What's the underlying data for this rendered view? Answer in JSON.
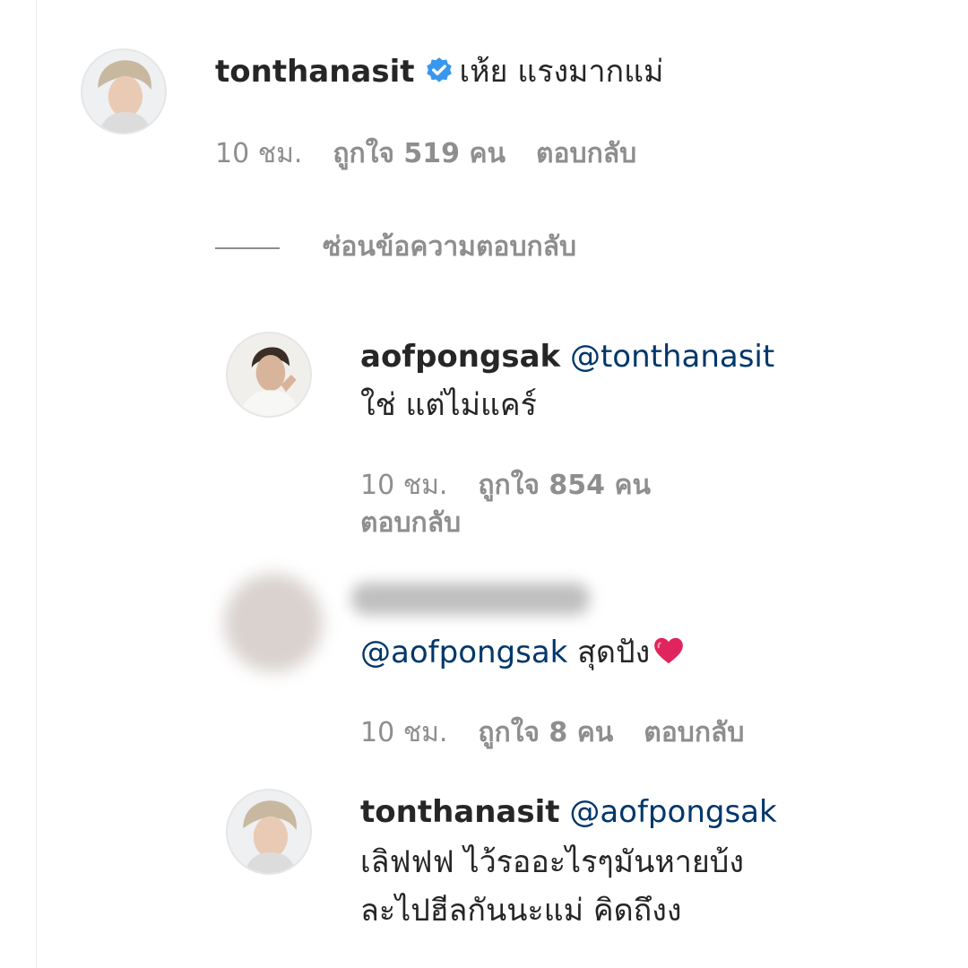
{
  "comments": [
    {
      "username": "tonthanasit",
      "verified": true,
      "text": "เห้ย แรงมากแม่",
      "time": "10 ชม.",
      "likes": "ถูกใจ 519 คน",
      "reply": "ตอบกลับ"
    }
  ],
  "hide_replies": "ซ่อนข้อความตอบกลับ",
  "replies": [
    {
      "username": "aofpongsak",
      "mention": "@tonthanasit",
      "text": "ใช่ แต่ไม่แคร์",
      "time": "10 ชม.",
      "likes": "ถูกใจ 854 คน",
      "reply": "ตอบกลับ"
    },
    {
      "username": "",
      "mention": "@aofpongsak",
      "text": "สุดปัง",
      "emoji": "red-heart",
      "time": "10 ชม.",
      "likes": "ถูกใจ 8 คน",
      "reply": "ตอบกลับ"
    },
    {
      "username": "tonthanasit",
      "mention": "@aofpongsak",
      "text_line1": "เลิฟฟฟ ไว้รออะไรๆมันหายบ้ง",
      "text_line2": "ละไปฮีลกันนะแม่ คิดถึงง"
    }
  ],
  "icons": {
    "verified": "verified-badge-icon",
    "heart": "red-heart-icon"
  },
  "colors": {
    "text": "#262626",
    "meta": "#8e8e8e",
    "mention": "#00376b",
    "verified": "#3897f0",
    "heart": "#e0245e"
  }
}
